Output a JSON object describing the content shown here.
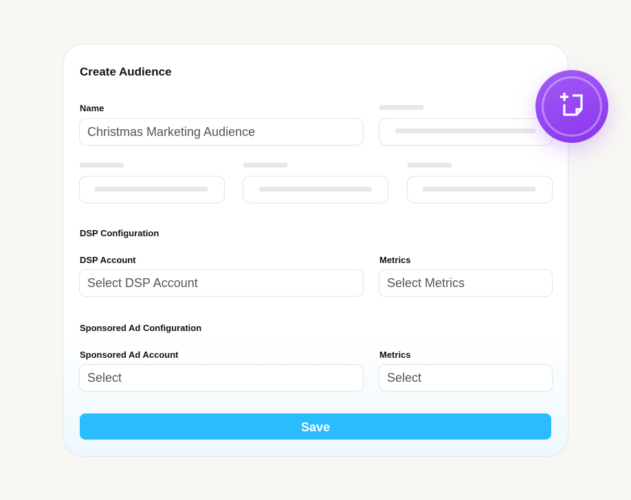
{
  "form": {
    "title": "Create Audience",
    "name_label": "Name",
    "name_value": "Christmas Marketing Audience",
    "dsp_section": "DSP Configuration",
    "dsp_account_label": "DSP Account",
    "dsp_account_value": "Select DSP Account",
    "dsp_metrics_label": "Metrics",
    "dsp_metrics_value": "Select Metrics",
    "sponsored_section": "Sponsored Ad Configuration",
    "sponsored_account_label": "Sponsored Ad Account",
    "sponsored_account_value": "Select",
    "sponsored_metrics_label": "Metrics",
    "sponsored_metrics_value": "Select",
    "save_label": "Save"
  },
  "colors": {
    "accent": "#2bbcfe",
    "badge": "#9645f2",
    "background": "#f8f7f4"
  },
  "badge_icon": "add-note-icon"
}
